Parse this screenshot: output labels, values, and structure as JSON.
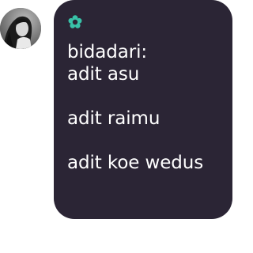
{
  "message": {
    "text": "bidadari:\nadit asu\n\nadit raimu\n\nadit koe wedus"
  },
  "icons": {
    "sender_badge": "flower-icon",
    "avatar": "profile-photo"
  },
  "colors": {
    "bubble_background": "#2b2535",
    "text": "#ffffff",
    "flower_accent": "#38c2a8",
    "page_background": "#ffffff"
  }
}
